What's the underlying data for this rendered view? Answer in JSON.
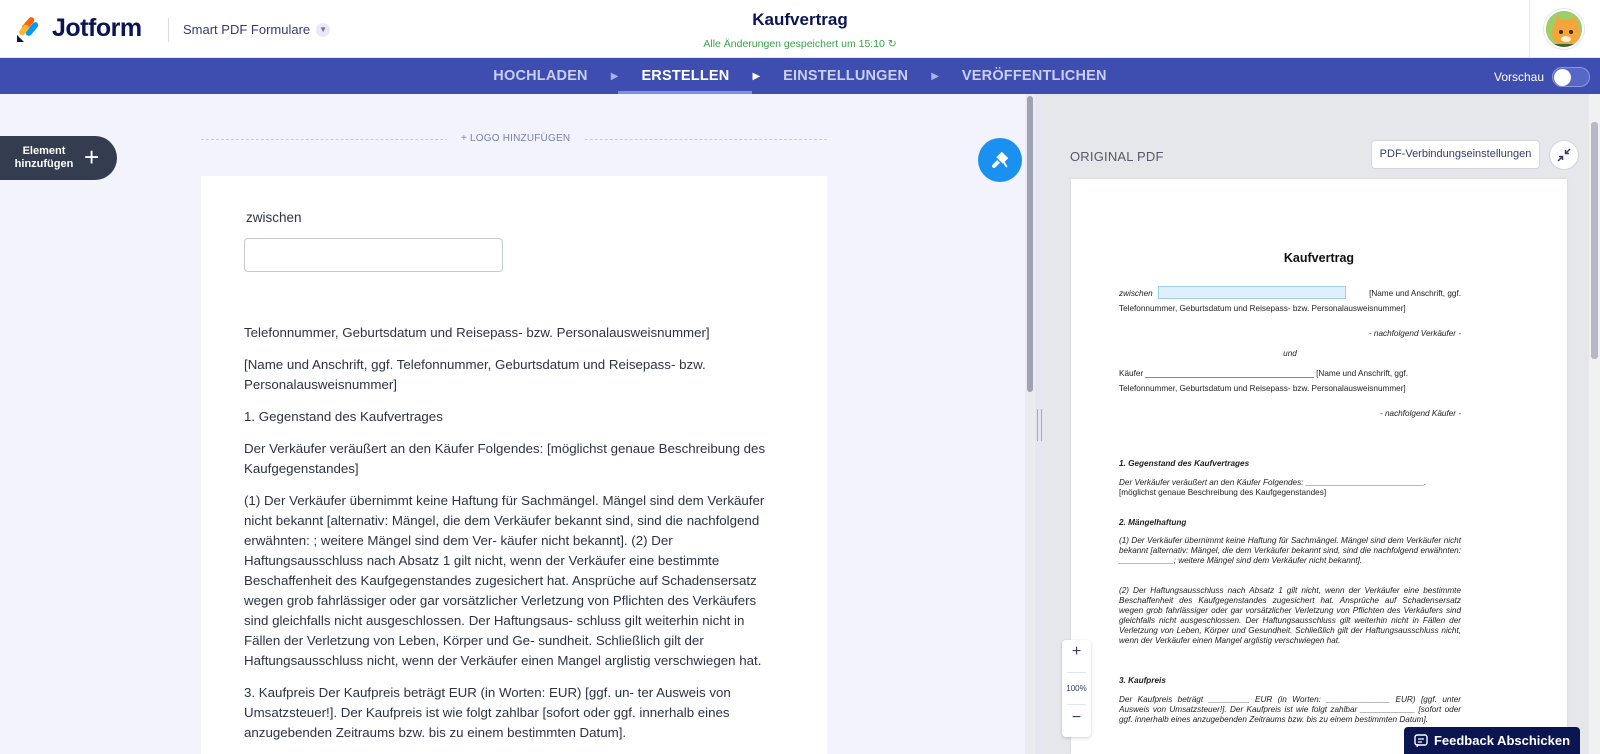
{
  "header": {
    "logo_text": "Jotform",
    "product": "Smart PDF Formulare",
    "doc_title": "Kaufvertrag",
    "saved_status": "Alle Änderungen gespeichert um 15:10"
  },
  "nav": {
    "steps": [
      "HOCHLADEN",
      "ERSTELLEN",
      "EINSTELLUNGEN",
      "VERÖFFENTLICHEN"
    ],
    "active_step": "ERSTELLEN",
    "preview_label": "Vorschau",
    "preview_on": false
  },
  "builder": {
    "add_element_label": "Element hinzufügen",
    "logo_add_label": "+ LOGO HINZUFÜGEN",
    "field_label": "zwischen",
    "field_value": "",
    "paragraphs": [
      "Telefonnummer, Geburtsdatum und Reisepass- bzw. Personalausweisnummer]",
      "[Name und Anschrift, ggf. Telefonnummer, Geburtsdatum und Reisepass- bzw. Personalausweisnummer]",
      "1. Gegenstand des Kaufvertrages",
      "Der Verkäufer veräußert an den Käufer Folgendes: [möglichst genaue Beschreibung des Kaufgegenstandes]",
      "(1) Der Verkäufer übernimmt keine Haftung für Sachmängel. Mängel sind dem Verkäufer nicht bekannt [alternativ: Mängel, die dem Verkäufer bekannt sind, sind die nachfolgend erwähnten: ; weitere Mängel sind dem Ver- käufer nicht bekannt]. (2) Der Haftungsausschluss nach Absatz 1 gilt nicht, wenn der Verkäufer eine bestimmte Beschaffenheit des Kaufgegenstandes zugesichert hat. Ansprüche auf Schadensersatz wegen grob fahrlässiger oder gar vorsätzlicher Verletzung von Pflichten des Verkäufers sind gleichfalls nicht ausgeschlossen. Der Haftungsaus- schluss gilt weiterhin nicht in Fällen der Verletzung von Leben, Körper und Ge- sundheit. Schließlich gilt der Haftungsausschluss nicht, wenn der Verkäufer einen Mangel arglistig verschwiegen hat.",
      "3. Kaufpreis Der Kaufpreis beträgt EUR (in Worten: EUR) [ggf. un- ter Ausweis von Umsatzsteuer!]. Der Kaufpreis ist wie folgt zahlbar [sofort oder ggf. innerhalb eines anzugebenden Zeitraums bzw. bis zu einem bestimmten Datum]."
    ]
  },
  "pdf_panel": {
    "label": "ORIGINAL PDF",
    "connection_button": "PDF-Verbindungseinstellungen",
    "zoom": "100%",
    "page": {
      "title": "Kaufvertrag",
      "line1_prefix": "zwischen",
      "line1_suffix": "[Name und Anschrift, ggf.",
      "line2": "Telefonnummer, Geburtsdatum und Reisepass- bzw. Personalausweisnummer]",
      "seller_note": "- nachfolgend Verkäufer -",
      "und": "und",
      "buyer_line": "Käufer _____________________________________ [Name und Anschrift, ggf.",
      "buyer_line2": "Telefonnummer, Geburtsdatum und Reisepass- bzw. Personalausweisnummer]",
      "buyer_note": "- nachfolgend Käufer -",
      "s1_head": "1. Gegenstand des Kaufvertrages",
      "s1_text": "Der Verkäufer veräußert an den Käufer Folgendes: __________________________.",
      "s1_text2": "[möglichst genaue Beschreibung des Kaufgegenstandes]",
      "s2_head": "2. Mängelhaftung",
      "s2_p1": "(1) Der Verkäufer übernimmt keine Haftung für Sachmängel. Mängel sind dem Verkäufer nicht bekannt [alternativ: Mängel, die dem Verkäufer bekannt sind, sind die nachfolgend erwähnten: ____________; weitere Mängel sind dem Verkäufer nicht bekannt].",
      "s2_p2": "(2) Der Haftungsausschluss nach Absatz 1 gilt nicht, wenn der Verkäufer eine bestimmte Beschaffenheit des Kaufgegenstandes zugesichert hat. Ansprüche auf Schadensersatz wegen grob fahrlässiger oder gar vorsätzlicher Verletzung von Pflichten des Verkäufers sind gleichfalls nicht ausgeschlossen. Der Haftungsausschluss gilt weiterhin nicht in Fällen der Verletzung von Leben, Körper und Gesundheit. Schließlich gilt der Haftungsausschluss nicht, wenn der Verkäufer einen Mangel arglistig verschwiegen hat.",
      "s3_head": "3. Kaufpreis",
      "s3_text": "Der Kaufpreis beträgt _________ EUR (in Worten: ______________ EUR) [ggf. unter Ausweis von Umsatzsteuer!]. Der Kaufpreis ist wie folgt zahlbar ____________ [sofort oder ggf. innerhalb eines anzugebenden Zeitraums bzw. bis zu einem bestimmten Datum]."
    }
  },
  "feedback_label": "Feedback Abschicken",
  "colors": {
    "navbar": "#3e4eb0",
    "accent_blue": "#1a91f0",
    "dark": "#0a1551",
    "saved_green": "#3aa24a"
  }
}
